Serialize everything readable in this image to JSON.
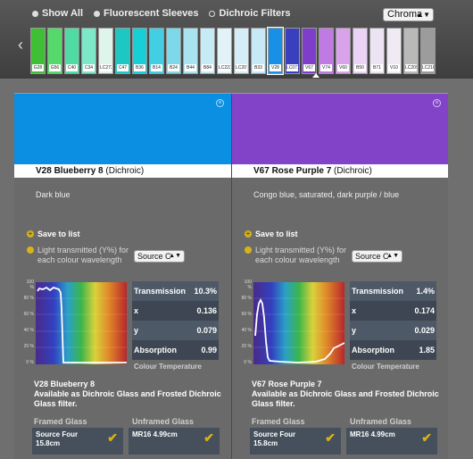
{
  "filters": {
    "options": [
      "Show All",
      "Fluorescent Sleeves",
      "Dichroic Filters"
    ],
    "selected": "Show All"
  },
  "sort_select": {
    "value": "Chroma"
  },
  "swatches": [
    {
      "code": "G28",
      "color": "#3fbf33"
    },
    {
      "code": "G56",
      "color": "#54d96a"
    },
    {
      "code": "C40",
      "color": "#4fdba3"
    },
    {
      "code": "C34",
      "color": "#7de8c8"
    },
    {
      "code": "LC272",
      "color": "#dff4ea"
    },
    {
      "code": "C47",
      "color": "#1fc7c2"
    },
    {
      "code": "B36",
      "color": "#18cfd8"
    },
    {
      "code": "B14",
      "color": "#42cfe3"
    },
    {
      "code": "B24",
      "color": "#7dd9ea"
    },
    {
      "code": "B44",
      "color": "#a8e3ef"
    },
    {
      "code": "B84",
      "color": "#c5ecf5"
    },
    {
      "code": "LC222",
      "color": "#e2f3f8"
    },
    {
      "code": "LC207",
      "color": "#d4edf7"
    },
    {
      "code": "B33",
      "color": "#c7e8f5"
    },
    {
      "code": "V28",
      "color": "#1a8fe6"
    },
    {
      "code": "LC071",
      "color": "#3a3fbe"
    },
    {
      "code": "V67",
      "color": "#7e3ec9"
    },
    {
      "code": "V74",
      "color": "#c07ae3"
    },
    {
      "code": "V60",
      "color": "#d9a3ec"
    },
    {
      "code": "B50",
      "color": "#ead3f4"
    },
    {
      "code": "B71",
      "color": "#ece4f3"
    },
    {
      "code": "V10",
      "color": "#f0eaf4"
    },
    {
      "code": "LC209",
      "color": "#b9b9b9"
    },
    {
      "code": "LC210",
      "color": "#9c9c9c"
    }
  ],
  "panels": [
    {
      "color": "#0a8fe3",
      "name": "V28 Blueberry 8",
      "type": "(Dichroic)",
      "description": "Dark blue",
      "save_label": "Save to list",
      "light_label": "Light transmitted (Y%) for each colour wavelength",
      "source": "Source C",
      "stats": {
        "transmission_label": "Transmission",
        "transmission": "10.3%",
        "x_label": "x",
        "x": "0.136",
        "y_label": "y",
        "y": "0.079",
        "absorption_label": "Absorption",
        "absorption": "0.99",
        "ct_label": "Colour Temperature"
      },
      "graph_curve": "blue",
      "avail_name": "V28 Blueberry 8",
      "avail_text": "Available as Dichroic Glass and Frosted Dichroic Glass filter.",
      "framed_label": "Framed Glass",
      "unframed_label": "Unframed Glass",
      "framed_value": "Source Four 15.8cm",
      "unframed_value": "MR16 4.99cm"
    },
    {
      "color": "#8243c9",
      "name": "V67 Rose Purple 7",
      "type": "(Dichroic)",
      "description": "Congo blue, saturated, dark purple / blue",
      "save_label": "Save to list",
      "light_label": "Light transmitted (Y%) for each colour wavelength",
      "source": "Source C",
      "stats": {
        "transmission_label": "Transmission",
        "transmission": "1.4%",
        "x_label": "x",
        "x": "0.174",
        "y_label": "y",
        "y": "0.029",
        "absorption_label": "Absorption",
        "absorption": "1.85",
        "ct_label": "Colour Temperature"
      },
      "graph_curve": "purple",
      "avail_name": "V67 Rose Purple 7",
      "avail_text": "Available as Dichroic Glass and Frosted Dichroic Glass filter.",
      "framed_label": "Framed Glass",
      "unframed_label": "Unframed Glass",
      "framed_value": "Source Four 15.8cm",
      "unframed_value": "MR16 4.99cm"
    }
  ],
  "graph_axis": [
    "100 %",
    "80 %",
    "60 %",
    "40 %",
    "20 %",
    "0 %"
  ]
}
